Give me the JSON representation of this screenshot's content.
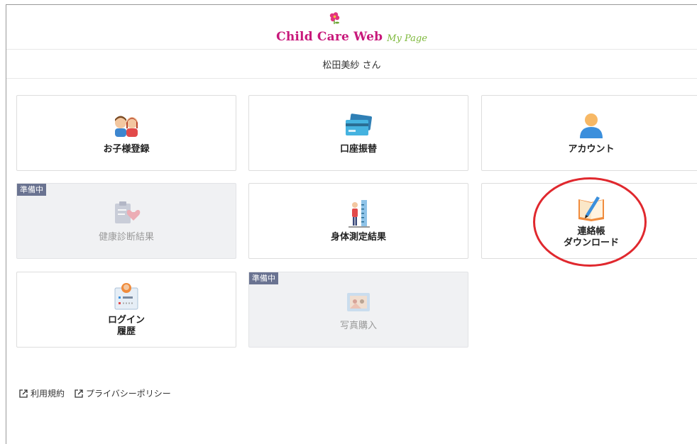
{
  "header": {
    "logo_main": "Child Care Web",
    "logo_sub": "My Page"
  },
  "user": {
    "name_label": "松田美紗 さん"
  },
  "menu": {
    "children_registration": {
      "label": "お子様登録",
      "icon": "children-icon"
    },
    "bank_transfer": {
      "label": "口座振替",
      "icon": "credit-card-icon"
    },
    "account": {
      "label": "アカウント",
      "icon": "user-icon"
    },
    "health_checkup": {
      "label": "健康診断結果",
      "badge": "準備中",
      "icon": "clipboard-heart-icon"
    },
    "body_measurement": {
      "label": "身体測定結果",
      "icon": "height-measure-icon"
    },
    "contact_book": {
      "label": "連絡帳\nダウンロード",
      "icon": "notebook-pen-icon"
    },
    "login_history": {
      "label": "ログイン\n履歴",
      "icon": "user-card-icon"
    },
    "photo_purchase": {
      "label": "写真購入",
      "badge": "準備中",
      "icon": "photo-icon"
    }
  },
  "footer": {
    "terms": "利用規約",
    "privacy": "プライバシーポリシー"
  },
  "colors": {
    "logo_pink": "#c8197b",
    "logo_green": "#7db83a",
    "badge_bg": "#6a7391",
    "highlight_red": "#e0282e"
  }
}
